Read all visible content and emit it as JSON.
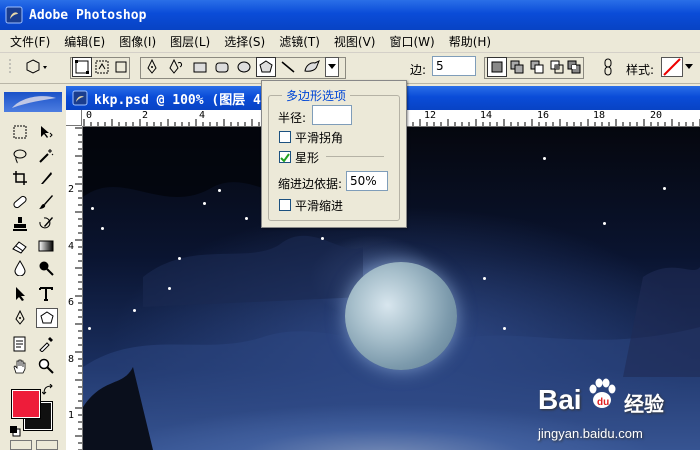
{
  "app": {
    "title": "Adobe Photoshop"
  },
  "menu": [
    "文件(F)",
    "编辑(E)",
    "图像(I)",
    "图层(L)",
    "选择(S)",
    "滤镜(T)",
    "视图(V)",
    "窗口(W)",
    "帮助(H)"
  ],
  "options": {
    "sides_label": "边:",
    "sides_value": "5",
    "style_label": "样式:"
  },
  "document": {
    "title": "kkp.psd @ 100% (图层 4"
  },
  "ruler": {
    "h_labels": [
      "0",
      "2",
      "4",
      "12",
      "14",
      "16",
      "18",
      "20"
    ],
    "v_labels": [
      "2",
      "4",
      "6",
      "8",
      "1"
    ]
  },
  "polygon_options": {
    "legend": "多边形选项",
    "radius_label": "半径:",
    "radius_value": "",
    "smooth_corners_label": "平滑拐角",
    "smooth_corners_checked": false,
    "star_label": "星形",
    "star_checked": true,
    "indent_label": "缩进边依据:",
    "indent_value": "50%",
    "smooth_indent_label": "平滑缩进",
    "smooth_indent_checked": false
  },
  "colors": {
    "foreground": "#ee1c3a",
    "background": "#101010",
    "title_blue": "#0a4cd8",
    "accent": "#0046d5"
  },
  "watermark": {
    "brand": "Bai",
    "brand_cn": "经验",
    "url": "jingyan.baidu.com"
  }
}
